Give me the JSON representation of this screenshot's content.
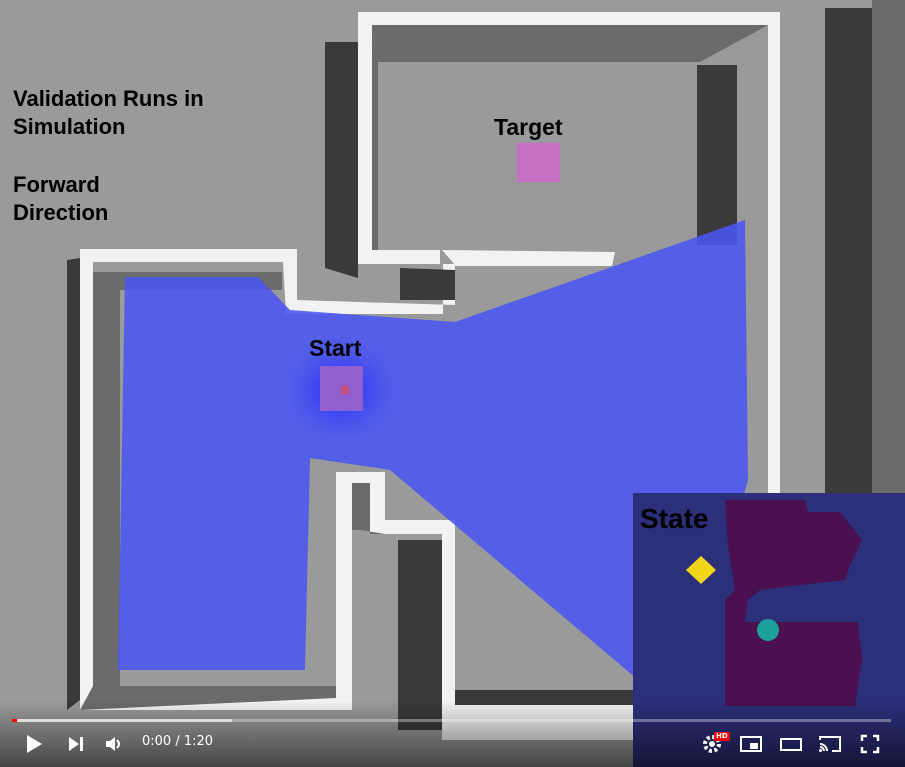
{
  "overlay": {
    "title": "Validation Runs in Simulation",
    "subtitle": "Forward Direction"
  },
  "scene": {
    "target_label": "Target",
    "start_label": "Start",
    "state_label": "State",
    "colors": {
      "floor": "#9a9a9a",
      "wall_top": "#f2f2f2",
      "wall_dark": "#3a3a3a",
      "wall_side": "#6b6b6b",
      "scan": "#4a55f0",
      "target_square": "#c670c6",
      "minimap_bg": "#2c2f7a",
      "minimap_region": "#4a1050",
      "minimap_target": "#f2d617",
      "minimap_agent": "#1aa19a"
    }
  },
  "player": {
    "time_current": "0:00",
    "time_separator": " / ",
    "time_total": "1:20",
    "hd_badge": "HD",
    "progress_played": 0.005,
    "progress_buffered": 0.25,
    "icons": [
      "play-icon",
      "next-icon",
      "volume-icon",
      "settings-icon",
      "miniplayer-icon",
      "theater-icon",
      "cast-icon",
      "fullscreen-icon"
    ]
  }
}
